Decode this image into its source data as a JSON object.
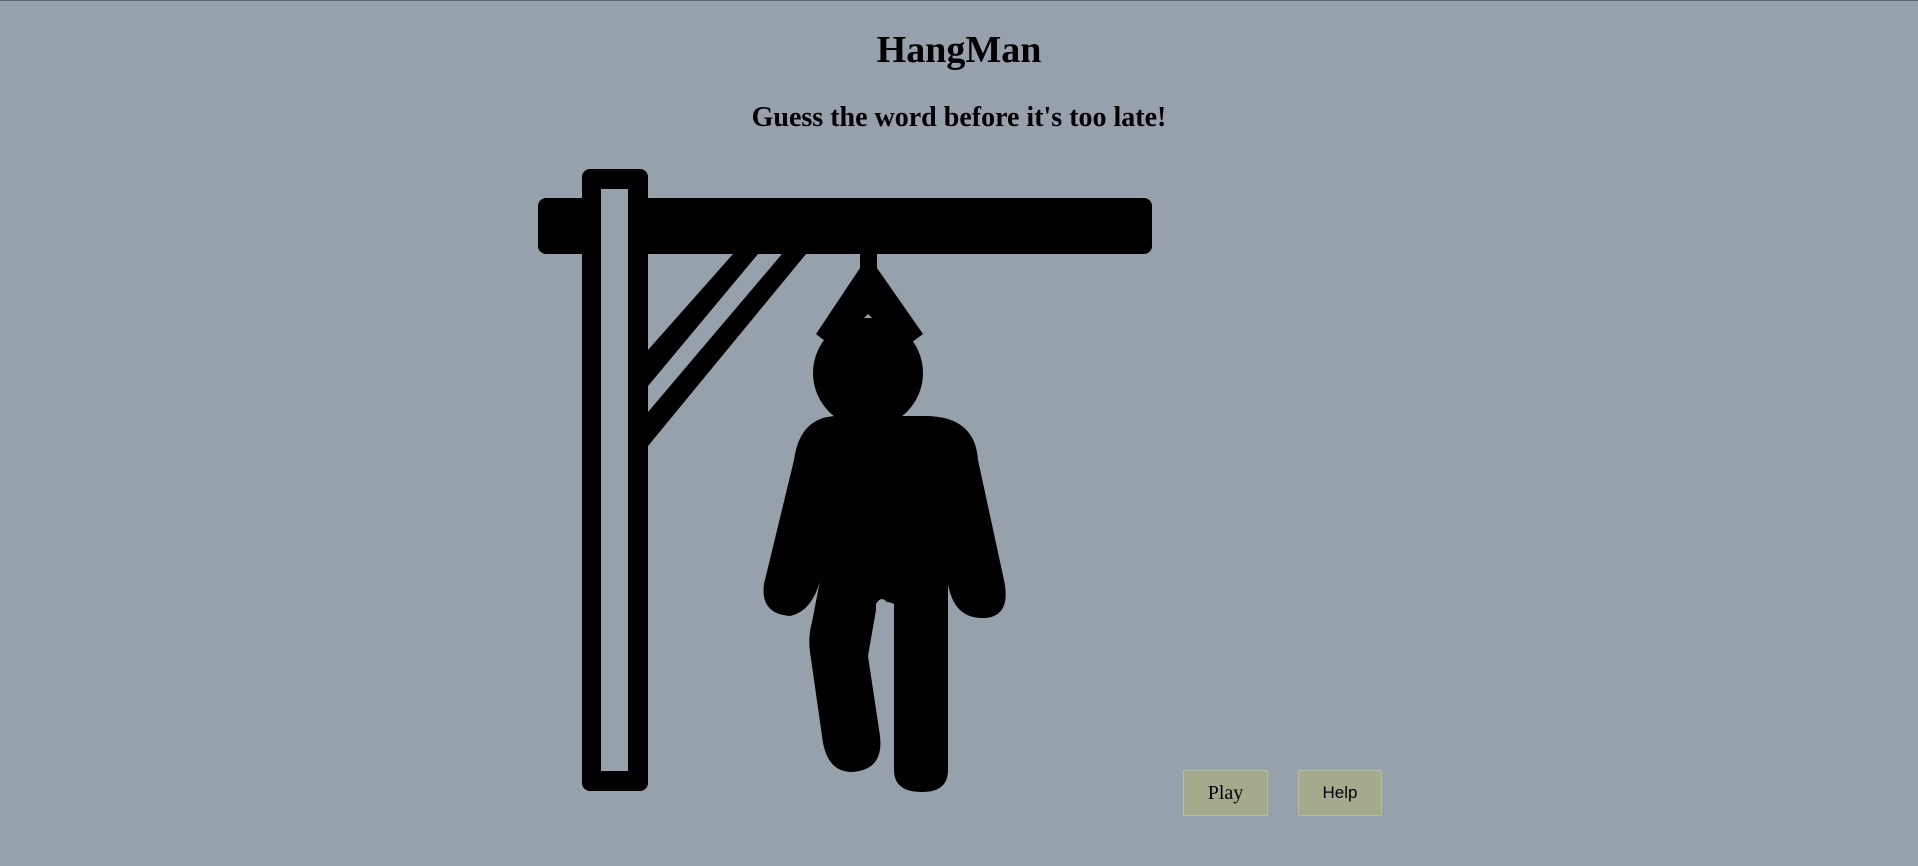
{
  "page": {
    "background_color": "#97a1ab"
  },
  "header": {
    "title": "HangMan",
    "subtitle": "Guess the word before it's too late!"
  },
  "illustration": {
    "icon": "hangman-gallows-icon",
    "color": "#000000"
  },
  "actions": {
    "play_label": "Play",
    "help_label": "Help",
    "button_color": "#a4ab8d"
  }
}
